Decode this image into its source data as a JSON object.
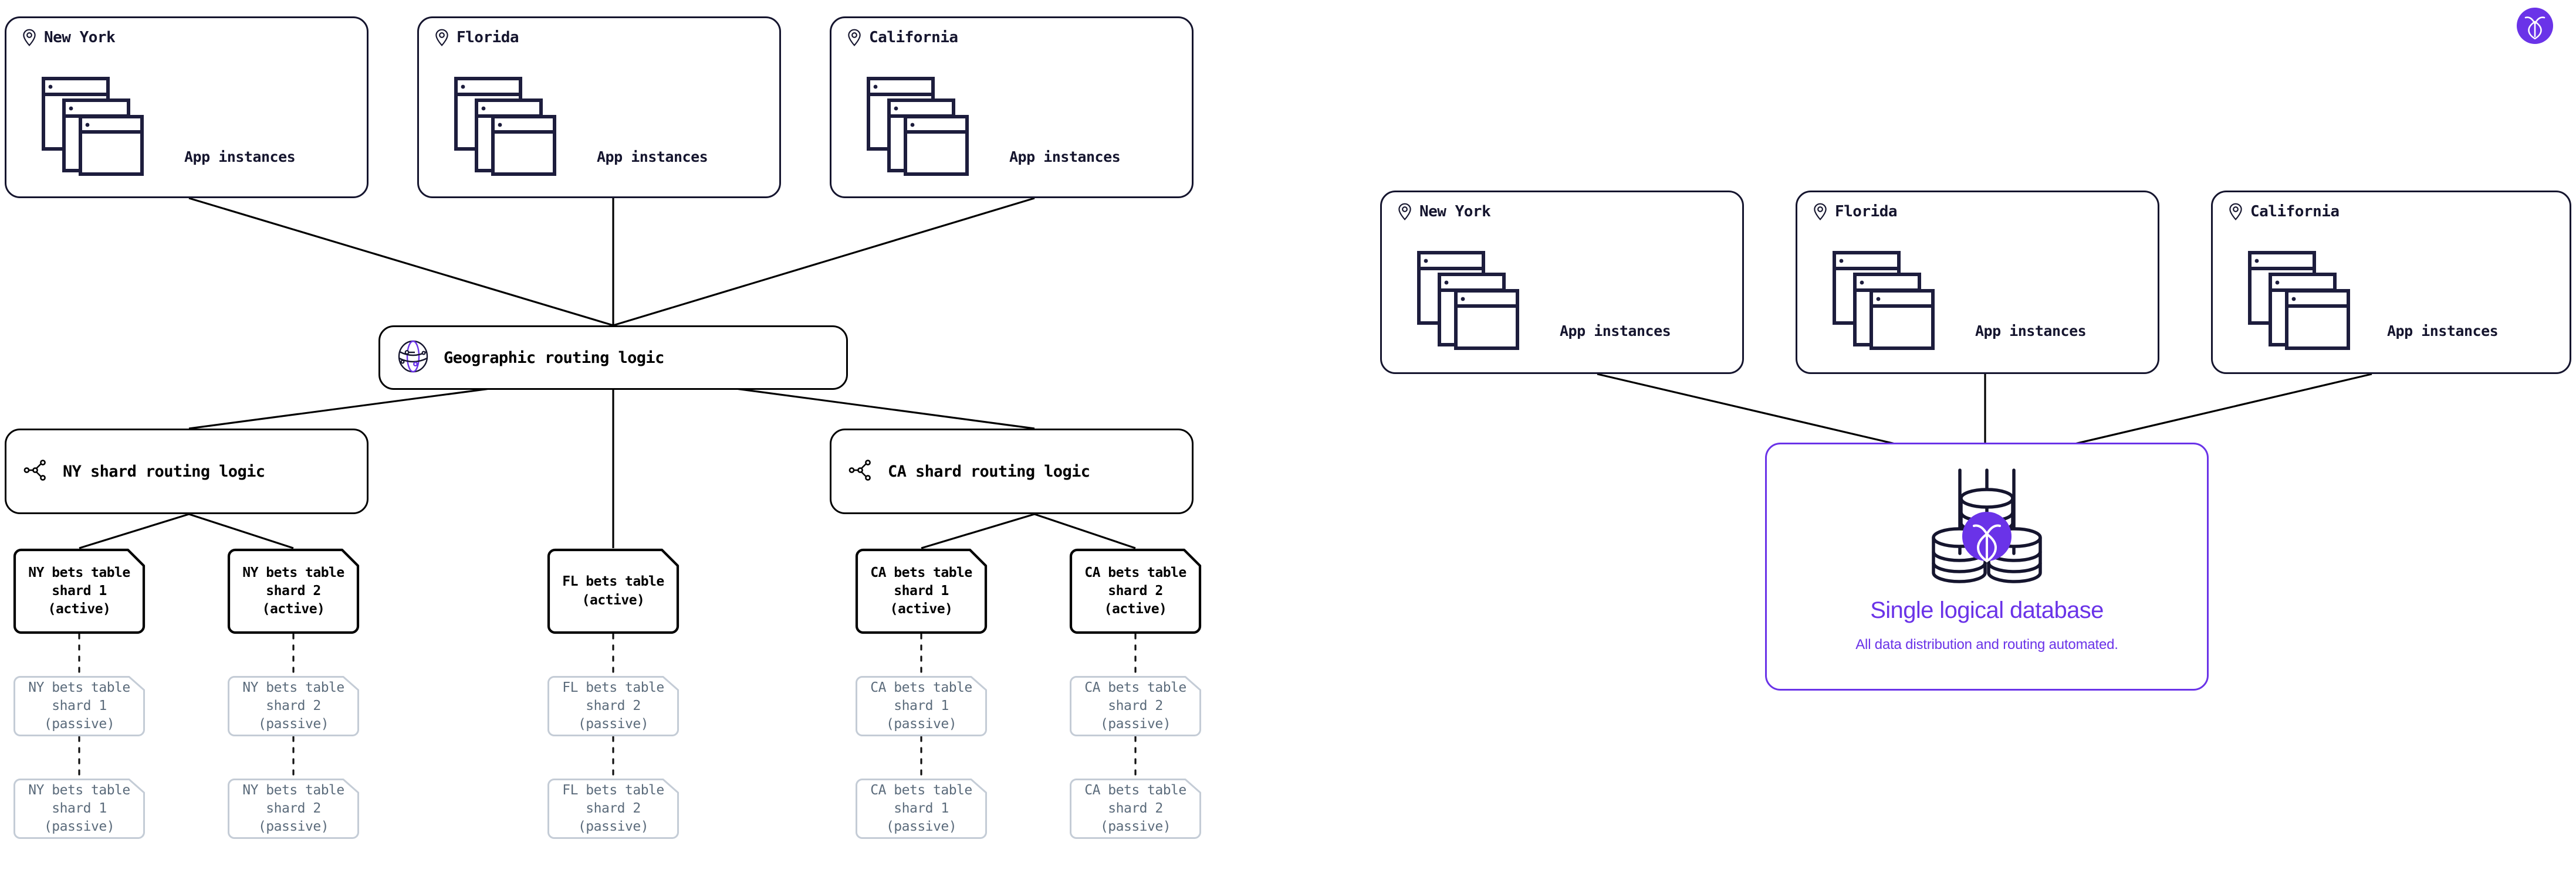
{
  "theme": {
    "accent": "#6a33e8",
    "ink": "#15152e",
    "line": "#000000",
    "passive": "#5b6b7b",
    "passive_border": "#c4ccd6",
    "background": "#ffffff"
  },
  "brand_badge": {
    "icon": "cockroachdb-logo-icon"
  },
  "left_diagram": {
    "location_cards": [
      {
        "name": "New York",
        "app_label": "App instances",
        "icon": "map-pin-icon",
        "stack_icon": "app-instances-stack-icon"
      },
      {
        "name": "Florida",
        "app_label": "App instances",
        "icon": "map-pin-icon",
        "stack_icon": "app-instances-stack-icon"
      },
      {
        "name": "California",
        "app_label": "App instances",
        "icon": "map-pin-icon",
        "stack_icon": "app-instances-stack-icon"
      }
    ],
    "geo_router": {
      "label": "Geographic routing logic",
      "icon": "globe-network-icon"
    },
    "shard_routers": [
      {
        "label": "NY shard routing logic",
        "icon": "share-nodes-icon"
      },
      {
        "label": "CA shard routing logic",
        "icon": "share-nodes-icon"
      }
    ],
    "tables": {
      "active": [
        {
          "lines": [
            "NY bets table",
            "shard 1",
            "(active)"
          ]
        },
        {
          "lines": [
            "NY bets table",
            "shard 2",
            "(active)"
          ]
        },
        {
          "lines": [
            "FL bets table",
            "(active)"
          ]
        },
        {
          "lines": [
            "CA bets table",
            "shard 1",
            "(active)"
          ]
        },
        {
          "lines": [
            "CA bets table",
            "shard 2",
            "(active)"
          ]
        }
      ],
      "passive_row_1": [
        {
          "lines": [
            "NY bets table",
            "shard 1",
            "(passive)"
          ]
        },
        {
          "lines": [
            "NY bets table",
            "shard 2",
            "(passive)"
          ]
        },
        {
          "lines": [
            "FL bets table",
            "shard 2",
            "(passive)"
          ]
        },
        {
          "lines": [
            "CA bets table",
            "shard 1",
            "(passive)"
          ]
        },
        {
          "lines": [
            "CA bets table",
            "shard 2",
            "(passive)"
          ]
        }
      ],
      "passive_row_2": [
        {
          "lines": [
            "NY bets table",
            "shard 1",
            "(passive)"
          ]
        },
        {
          "lines": [
            "NY bets table",
            "shard 2",
            "(passive)"
          ]
        },
        {
          "lines": [
            "FL bets table",
            "shard 2",
            "(passive)"
          ]
        },
        {
          "lines": [
            "CA bets table",
            "shard 1",
            "(passive)"
          ]
        },
        {
          "lines": [
            "CA bets table",
            "shard 2",
            "(passive)"
          ]
        }
      ]
    }
  },
  "right_diagram": {
    "location_cards": [
      {
        "name": "New York",
        "app_label": "App instances",
        "icon": "map-pin-icon",
        "stack_icon": "app-instances-stack-icon"
      },
      {
        "name": "Florida",
        "app_label": "App instances",
        "icon": "map-pin-icon",
        "stack_icon": "app-instances-stack-icon"
      },
      {
        "name": "California",
        "app_label": "App instances",
        "icon": "map-pin-icon",
        "stack_icon": "app-instances-stack-icon"
      }
    ],
    "hero": {
      "title": "Single logical database",
      "subtitle": "All data distribution and routing automated.",
      "icon": "database-cluster-icon"
    }
  }
}
